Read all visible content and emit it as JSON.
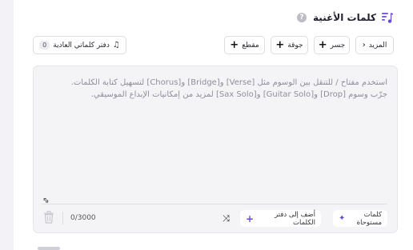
{
  "header": {
    "title": "كلمات الأغنية",
    "help_glyph": "?"
  },
  "toolbar": {
    "more_label": "المزيد",
    "section_buttons": [
      "جسر",
      "جوقة",
      "مقطع"
    ],
    "notebook_label": "دفتر كلماتي العادية",
    "notebook_count": "0"
  },
  "editor": {
    "placeholder_line1": "استخدم مفتاح / للتنقل بين الوسوم مثل [Verse] و[Bridge] و[Chorus] لتسهيل كتابة الكلمات.",
    "placeholder_line2": "جرّب وسوم [Drop] و[Guitar Solo] و[Sax Solo] لمزيد من إمكانيات الإبداع الموسيقي.",
    "counter": "0/3000",
    "add_to_notebook_label": "أضف إلى دفتر الكلمات",
    "inspired_label": "كلمات مستوحاة"
  },
  "colors": {
    "accent": "#6a4bd8",
    "panel_bg": "#ffffff",
    "page_bg": "#f3f3f7",
    "editor_bg": "#f4f4f7"
  },
  "icons": [
    "music-notes-icon",
    "help-icon",
    "chevron-left-icon",
    "plus-icon",
    "notes-list-icon",
    "resize-icon",
    "trash-icon",
    "shuffle-icon",
    "sparkle-icon"
  ]
}
